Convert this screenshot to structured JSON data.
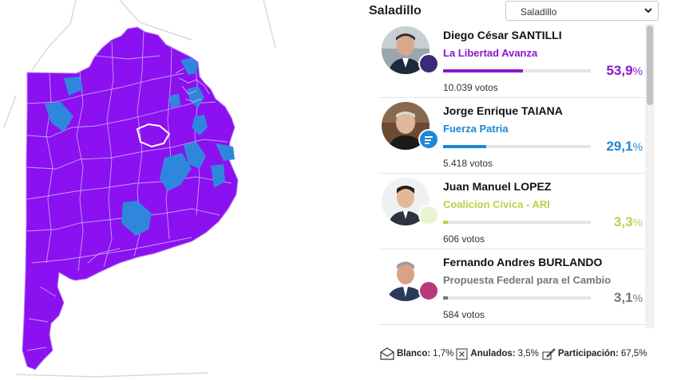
{
  "panel": {
    "title": "Saladillo",
    "select_value": "Saladillo"
  },
  "candidates": [
    {
      "name": "Diego César SANTILLI",
      "party": "La Libertad Avanza",
      "party_color": "#8a17c9",
      "percent_value": "53,9",
      "percent": 53.9,
      "votes": "10.039 votos",
      "badge_icon": "lla-logo-icon"
    },
    {
      "name": "Jorge Enrique TAIANA",
      "party": "Fuerza Patria",
      "party_color": "#1d87d6",
      "percent_value": "29,1",
      "percent": 29.1,
      "votes": "5.418 votos",
      "badge_icon": "fuerza-patria-logo-icon"
    },
    {
      "name": "Juan Manuel LOPEZ",
      "party": "Coalicion Cívica - ARI",
      "party_color": "#b7d24a",
      "percent_value": "3,3",
      "percent": 3.3,
      "votes": "606 votos",
      "badge_icon": "cc-ari-logo-icon"
    },
    {
      "name": "Fernando Andres BURLANDO",
      "party": "Propuesta Federal para el Cambio",
      "party_color": "#777777",
      "percent_value": "3,1",
      "percent": 3.1,
      "votes": "584 votos",
      "badge_icon": "propuesta-federal-logo-icon"
    }
  ],
  "percent_symbol": "%",
  "footer": {
    "blanco_label": "Blanco:",
    "blanco_value": "1,7%",
    "anulados_label": "Anulados:",
    "anulados_value": "3,5%",
    "participacion_label": "Participación:",
    "participacion_value": "67,5%"
  },
  "colors": {
    "map_primary": "#8b11f0",
    "map_secondary": "#2f87dd"
  }
}
